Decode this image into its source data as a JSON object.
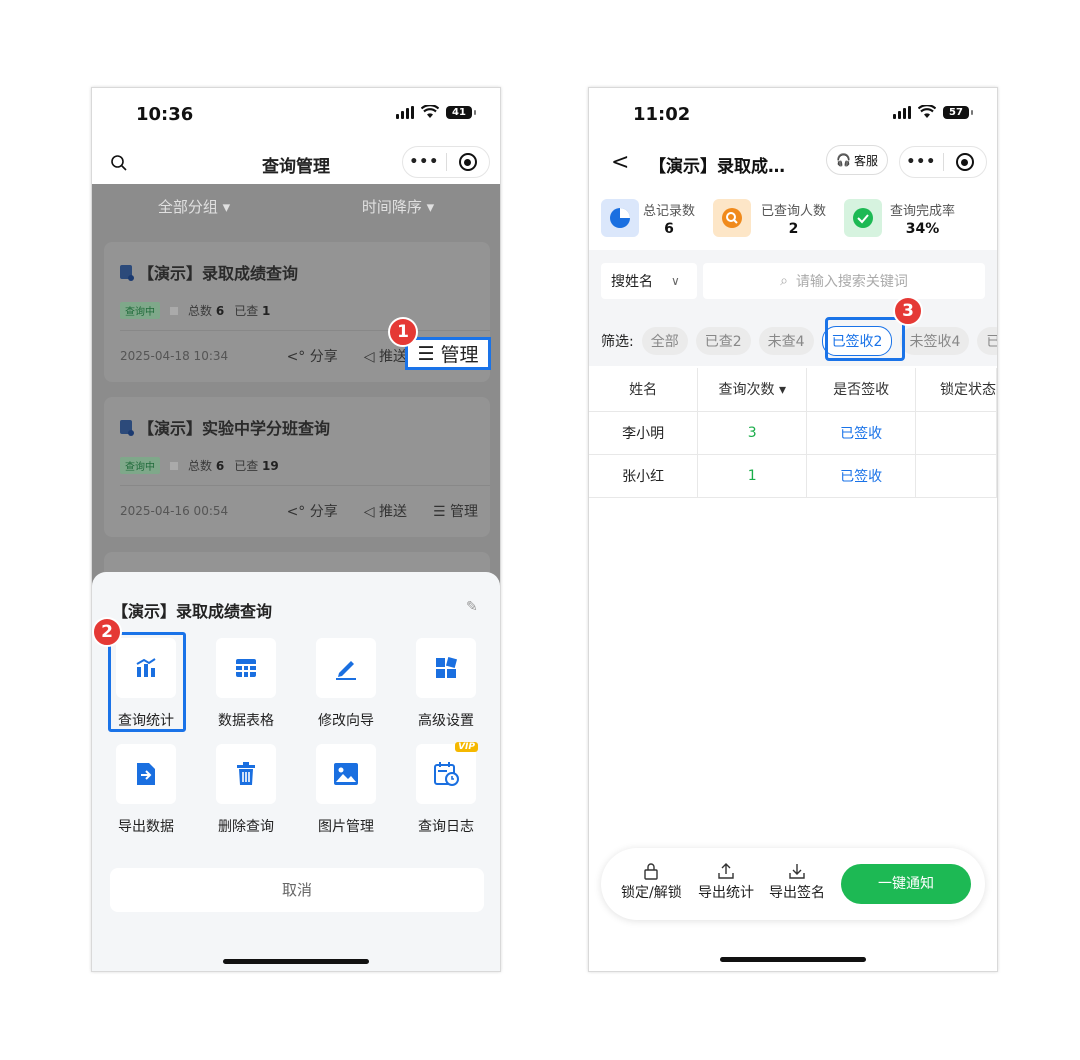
{
  "left": {
    "status_time": "10:36",
    "battery": "41",
    "title": "查询管理",
    "filters": [
      "全部分组 ▾",
      "时间降序 ▾"
    ],
    "cards": [
      {
        "title": "【演示】录取成绩查询",
        "badge": "查询中",
        "total_label": "总数",
        "total": "6",
        "checked_label": "已查",
        "checked": "1",
        "date": "2025-04-18 10:34"
      },
      {
        "title": "【演示】实验中学分班查询",
        "badge": "查询中",
        "total_label": "总数",
        "total": "6",
        "checked_label": "已查",
        "checked": "19",
        "date": "2025-04-16 00:54"
      }
    ],
    "actions": {
      "share": "分享",
      "push": "推送",
      "manage": "管理"
    },
    "badge1": "1",
    "badge2": "2",
    "sheet": {
      "title": "【演示】录取成绩查询",
      "tiles": [
        {
          "label": "查询统计",
          "icon": "stats-chart-icon"
        },
        {
          "label": "数据表格",
          "icon": "table-icon"
        },
        {
          "label": "修改向导",
          "icon": "edit-icon"
        },
        {
          "label": "高级设置",
          "icon": "settings-grid-icon"
        },
        {
          "label": "导出数据",
          "icon": "export-file-icon"
        },
        {
          "label": "删除查询",
          "icon": "trash-icon"
        },
        {
          "label": "图片管理",
          "icon": "image-icon"
        },
        {
          "label": "查询日志",
          "icon": "calendar-log-icon"
        }
      ],
      "vip": "VIP",
      "cancel": "取消"
    }
  },
  "right": {
    "status_time": "11:02",
    "battery": "57",
    "title": "【演示】录取成…",
    "kefu": "客服",
    "stats": [
      {
        "label": "总记录数",
        "value": "6"
      },
      {
        "label": "已查询人数",
        "value": "2"
      },
      {
        "label": "查询完成率",
        "value": "34%"
      }
    ],
    "select_label": "搜姓名",
    "search_placeholder": "请输入搜索关键词",
    "filter_label": "筛选:",
    "chips": [
      "全部",
      "已查2",
      "未查4",
      "已签收2",
      "未签收4",
      "已"
    ],
    "badge3": "3",
    "table": {
      "headers": [
        "姓名",
        "查询次数 ▾",
        "是否签收",
        "锁定状态"
      ],
      "rows": [
        [
          "李小明",
          "3",
          "已签收",
          ""
        ],
        [
          "张小红",
          "1",
          "已签收",
          ""
        ]
      ]
    },
    "bottom": {
      "lock": "锁定/解锁",
      "export_stats": "导出统计",
      "export_sign": "导出签名",
      "notify": "一键通知"
    }
  }
}
